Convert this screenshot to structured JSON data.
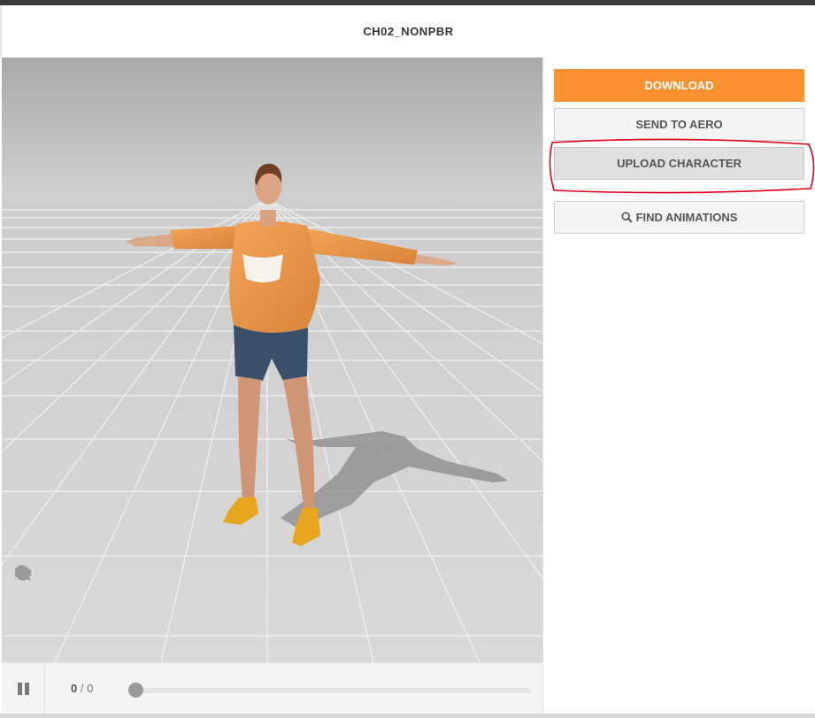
{
  "header": {
    "title": "CH02_NONPBR"
  },
  "actions": {
    "download": "DOWNLOAD",
    "send_to_aero": "SEND TO AERO",
    "upload_character": "UPLOAD CHARACTER",
    "find_animations": "FIND ANIMATIONS"
  },
  "player": {
    "frame_current": "0",
    "frame_separator": "/",
    "frame_total": "0",
    "progress": 0
  },
  "viewport_tools": [
    "skeleton-icon",
    "rotate-icon",
    "move-icon",
    "zoom-icon",
    "power-icon",
    "camera-icon"
  ],
  "colors": {
    "accent": "#fb9130",
    "annotation": "#e0001a"
  }
}
